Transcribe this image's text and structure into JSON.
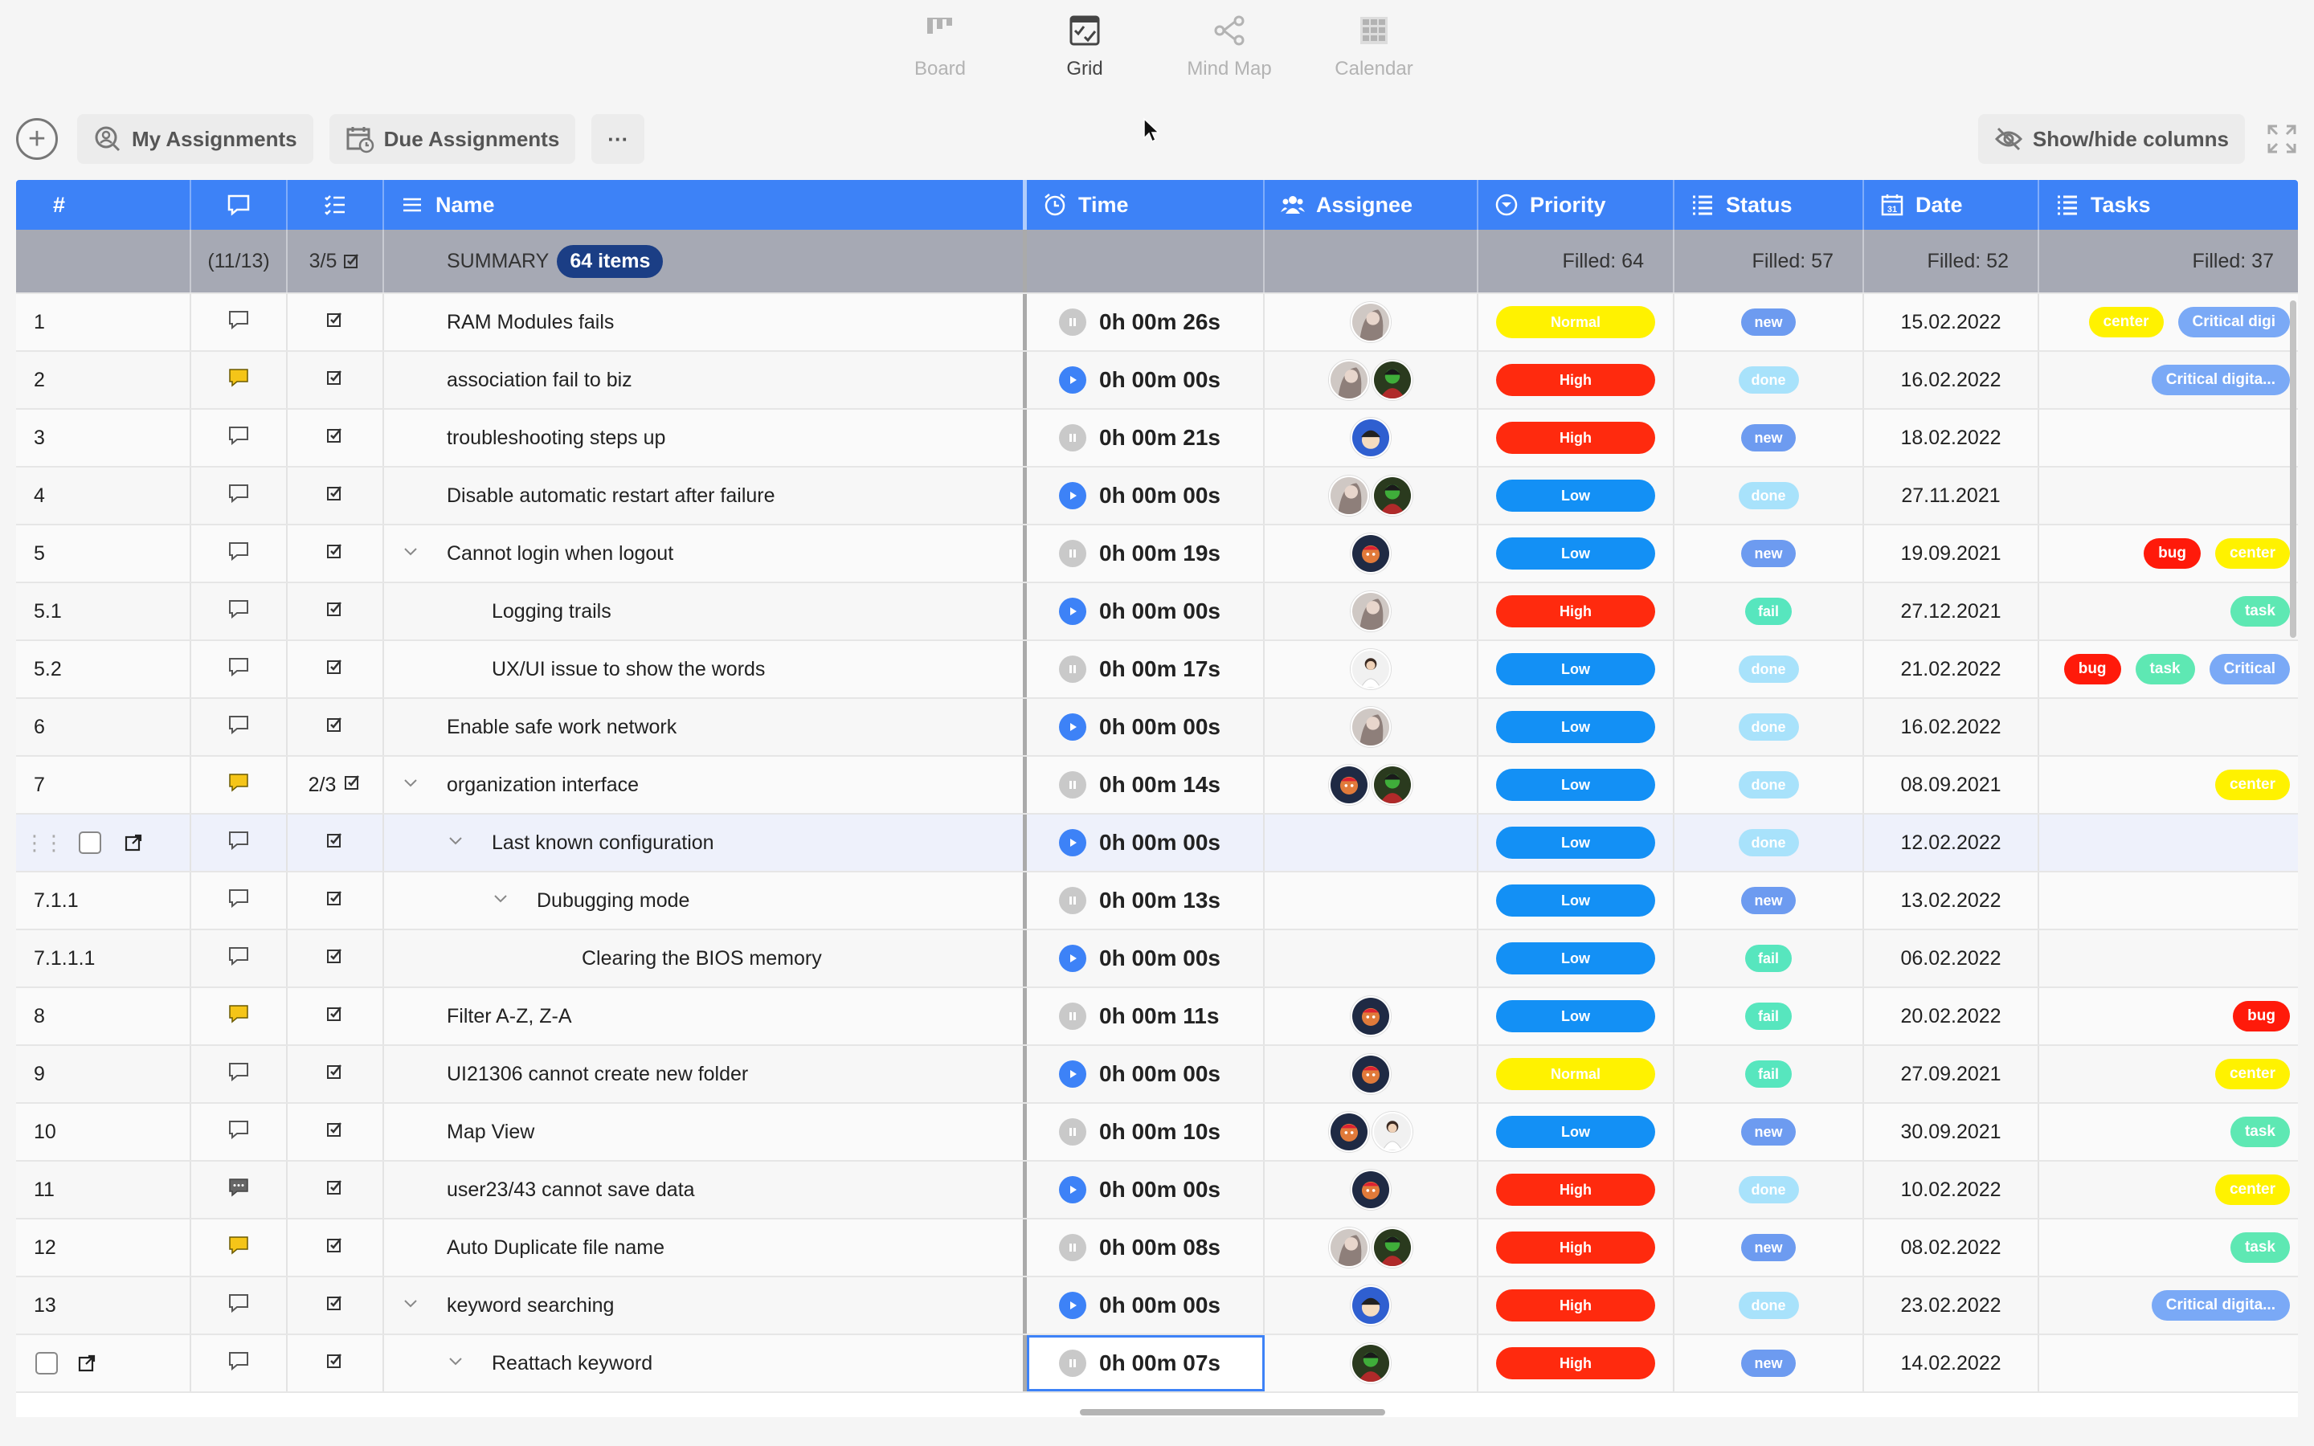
{
  "views": [
    {
      "label": "Board",
      "icon": "board-icon",
      "active": false
    },
    {
      "label": "Grid",
      "icon": "grid-icon",
      "active": true
    },
    {
      "label": "Mind Map",
      "icon": "mind-map-icon",
      "active": false
    },
    {
      "label": "Calendar",
      "icon": "calendar-icon",
      "active": false
    }
  ],
  "toolbar": {
    "my_assignments": "My Assignments",
    "due_assignments": "Due Assignments",
    "more": "···",
    "show_hide": "Show/hide columns"
  },
  "columns": {
    "num": "#",
    "name": "Name",
    "time": "Time",
    "assignee": "Assignee",
    "priority": "Priority",
    "status": "Status",
    "date": "Date",
    "tasks": "Tasks"
  },
  "summary": {
    "comments": "(11/13)",
    "checklist": "3/5",
    "label": "SUMMARY",
    "count": "64 items",
    "priority": "Filled: 64",
    "status": "Filled: 57",
    "date": "Filled: 52",
    "tasks": "Filled: 37"
  },
  "colors": {
    "header": "#3d82f7",
    "High": "#ff2a0e",
    "Low": "#1390f5",
    "Normal": "#fff200",
    "new": "#6d9bf0",
    "done": "#a8e2fb",
    "fail": "#57e6be",
    "center": "#fff200",
    "bug": "#ff1a0a",
    "task": "#5ee8b3",
    "critical": "#7aa9f6"
  },
  "rows": [
    {
      "num": "1",
      "comment": "plain",
      "check": "",
      "name": "RAM Modules fails",
      "indent": 0,
      "chev": false,
      "timer": "pause",
      "time": "0h 00m 26s",
      "avatars": [
        "a1"
      ],
      "priority": "Normal",
      "status": "new",
      "date": "15.02.2022",
      "tasks": [
        "center",
        "Critical digi"
      ]
    },
    {
      "num": "2",
      "comment": "yellow",
      "check": "",
      "name": "association fail to biz",
      "indent": 0,
      "chev": false,
      "timer": "play",
      "time": "0h 00m 00s",
      "avatars": [
        "a1",
        "a2"
      ],
      "priority": "High",
      "status": "done",
      "date": "16.02.2022",
      "tasks": [
        "Critical digita..."
      ]
    },
    {
      "num": "3",
      "comment": "plain",
      "check": "",
      "name": "troubleshooting steps up",
      "indent": 0,
      "chev": false,
      "timer": "pause",
      "time": "0h 00m 21s",
      "avatars": [
        "a3"
      ],
      "priority": "High",
      "status": "new",
      "date": "18.02.2022",
      "tasks": []
    },
    {
      "num": "4",
      "comment": "plain",
      "check": "",
      "name": "Disable automatic restart after failure",
      "indent": 0,
      "chev": false,
      "timer": "play",
      "time": "0h 00m 00s",
      "avatars": [
        "a1",
        "a2"
      ],
      "priority": "Low",
      "status": "done",
      "date": "27.11.2021",
      "tasks": []
    },
    {
      "num": "5",
      "comment": "plain",
      "check": "",
      "name": "Cannot login when logout",
      "indent": 0,
      "chev": true,
      "timer": "pause",
      "time": "0h 00m 19s",
      "avatars": [
        "a4"
      ],
      "priority": "Low",
      "status": "new",
      "date": "19.09.2021",
      "tasks": [
        "bug",
        "center"
      ]
    },
    {
      "num": "5.1",
      "comment": "plain",
      "check": "",
      "name": "Logging trails",
      "indent": 1,
      "chev": false,
      "timer": "play",
      "time": "0h 00m 00s",
      "avatars": [
        "a1"
      ],
      "priority": "High",
      "status": "fail",
      "date": "27.12.2021",
      "tasks": [
        "task"
      ]
    },
    {
      "num": "5.2",
      "comment": "plain",
      "check": "",
      "name": "UX/UI issue to show the words",
      "indent": 1,
      "chev": false,
      "timer": "pause",
      "time": "0h 00m 17s",
      "avatars": [
        "a5"
      ],
      "priority": "Low",
      "status": "done",
      "date": "21.02.2022",
      "tasks": [
        "bug",
        "task",
        "Critical"
      ]
    },
    {
      "num": "6",
      "comment": "plain",
      "check": "",
      "name": "Enable safe work network",
      "indent": 0,
      "chev": false,
      "timer": "play",
      "time": "0h 00m 00s",
      "avatars": [
        "a1"
      ],
      "priority": "Low",
      "status": "done",
      "date": "16.02.2022",
      "tasks": []
    },
    {
      "num": "7",
      "comment": "yellow",
      "check": "2/3",
      "name": "organization interface",
      "indent": 0,
      "chev": true,
      "timer": "pause",
      "time": "0h 00m 14s",
      "avatars": [
        "a4",
        "a2"
      ],
      "priority": "Low",
      "status": "done",
      "date": "08.09.2021",
      "tasks": [
        "center"
      ]
    },
    {
      "num": "",
      "comment": "plain",
      "check": "",
      "name": "Last known configuration",
      "indent": 1,
      "chev": true,
      "timer": "play",
      "time": "0h 00m 00s",
      "avatars": [],
      "priority": "Low",
      "status": "done",
      "date": "12.02.2022",
      "tasks": [],
      "selected": true
    },
    {
      "num": "7.1.1",
      "comment": "plain",
      "check": "",
      "name": "Dubugging mode",
      "indent": 2,
      "chev": true,
      "timer": "pause",
      "time": "0h 00m 13s",
      "avatars": [],
      "priority": "Low",
      "status": "new",
      "date": "13.02.2022",
      "tasks": []
    },
    {
      "num": "7.1.1.1",
      "comment": "plain",
      "check": "",
      "name": "Clearing the BIOS memory",
      "indent": 3,
      "chev": false,
      "timer": "play",
      "time": "0h 00m 00s",
      "avatars": [],
      "priority": "Low",
      "status": "fail",
      "date": "06.02.2022",
      "tasks": []
    },
    {
      "num": "8",
      "comment": "yellow",
      "check": "",
      "name": "Filter A-Z, Z-A",
      "indent": 0,
      "chev": false,
      "timer": "pause",
      "time": "0h 00m 11s",
      "avatars": [
        "a4"
      ],
      "priority": "Low",
      "status": "fail",
      "date": "20.02.2022",
      "tasks": [
        "bug"
      ]
    },
    {
      "num": "9",
      "comment": "plain",
      "check": "",
      "name": "UI21306 cannot create new folder",
      "indent": 0,
      "chev": false,
      "timer": "play",
      "time": "0h 00m 00s",
      "avatars": [
        "a4"
      ],
      "priority": "Normal",
      "status": "fail",
      "date": "27.09.2021",
      "tasks": [
        "center"
      ]
    },
    {
      "num": "10",
      "comment": "plain",
      "check": "",
      "name": "Map View",
      "indent": 0,
      "chev": false,
      "timer": "pause",
      "time": "0h 00m 10s",
      "avatars": [
        "a4",
        "a5"
      ],
      "priority": "Low",
      "status": "new",
      "date": "30.09.2021",
      "tasks": [
        "task"
      ]
    },
    {
      "num": "11",
      "comment": "dark",
      "check": "",
      "name": "user23/43 cannot save data",
      "indent": 0,
      "chev": false,
      "timer": "play",
      "time": "0h 00m 00s",
      "avatars": [
        "a4"
      ],
      "priority": "High",
      "status": "done",
      "date": "10.02.2022",
      "tasks": [
        "center"
      ]
    },
    {
      "num": "12",
      "comment": "yellow",
      "check": "",
      "name": "Auto Duplicate file name",
      "indent": 0,
      "chev": false,
      "timer": "pause",
      "time": "0h 00m 08s",
      "avatars": [
        "a1",
        "a2"
      ],
      "priority": "High",
      "status": "new",
      "date": "08.02.2022",
      "tasks": [
        "task"
      ]
    },
    {
      "num": "13",
      "comment": "plain",
      "check": "",
      "name": "keyword searching",
      "indent": 0,
      "chev": true,
      "timer": "play",
      "time": "0h 00m 00s",
      "avatars": [
        "a3"
      ],
      "priority": "High",
      "status": "done",
      "date": "23.02.2022",
      "tasks": [
        "Critical digita..."
      ]
    },
    {
      "num": "",
      "comment": "plain",
      "check": "",
      "name": "Reattach keyword",
      "indent": 1,
      "chev": true,
      "timer": "pause",
      "time": "0h 00m 07s",
      "avatars": [
        "a2"
      ],
      "priority": "High",
      "status": "new",
      "date": "14.02.2022",
      "tasks": [],
      "editing": true,
      "checkbox_only": true
    }
  ]
}
